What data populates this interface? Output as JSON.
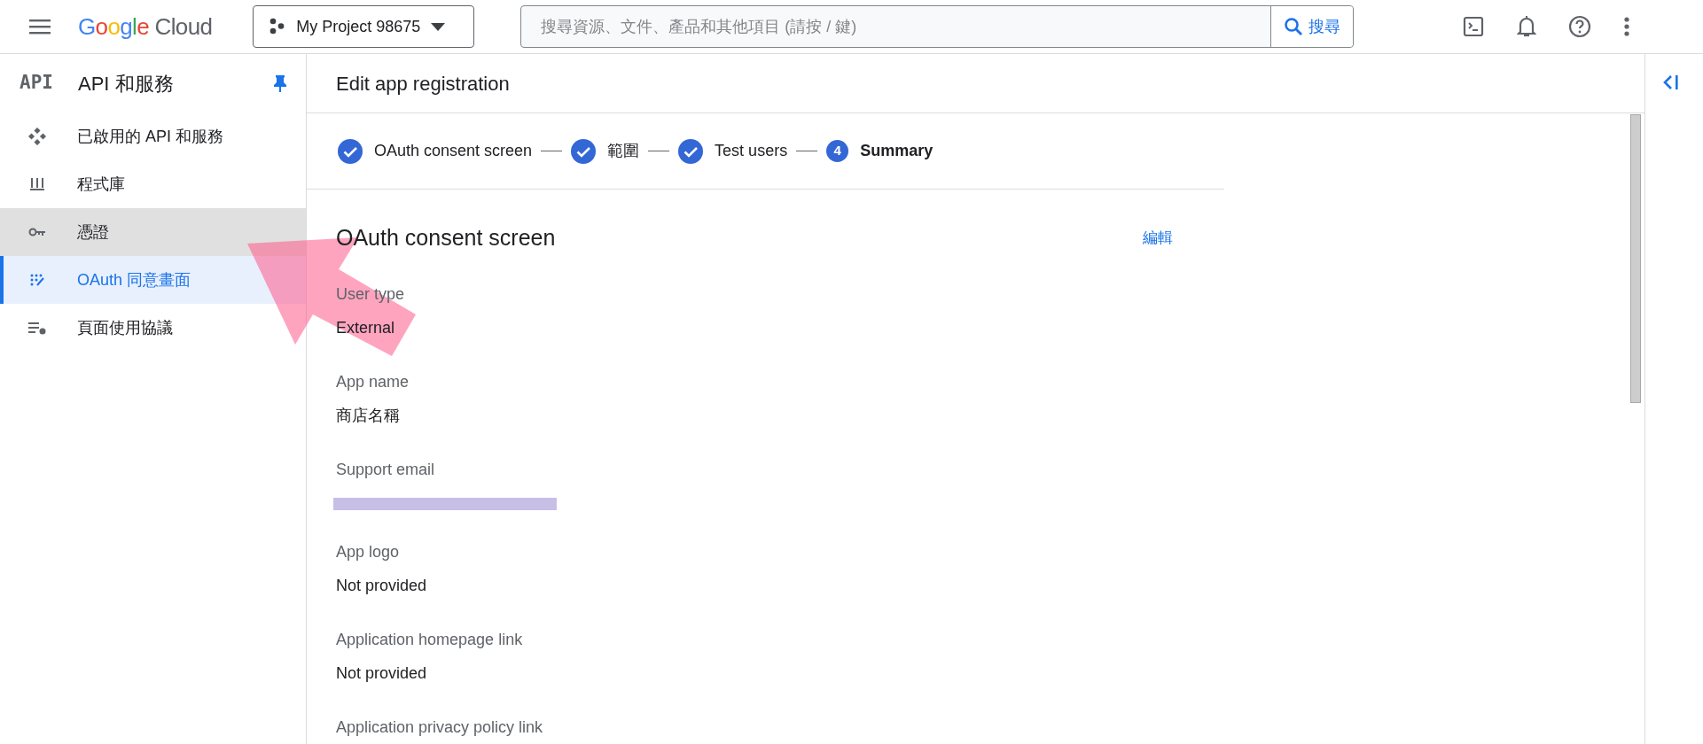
{
  "header": {
    "logo": "Google Cloud",
    "project": "My Project 98675",
    "search": {
      "placeholder": "搜尋資源、文件、產品和其他項目 (請按 / 鍵)",
      "button": "搜尋"
    }
  },
  "sidebar": {
    "badge": "API",
    "title": "API 和服務",
    "pinned": true,
    "items": [
      {
        "label": "已啟用的 API 和服務",
        "selected": false,
        "highlighted": false
      },
      {
        "label": "程式庫",
        "selected": false,
        "highlighted": false
      },
      {
        "label": "憑證",
        "selected": false,
        "highlighted": true
      },
      {
        "label": "OAuth 同意畫面",
        "selected": true,
        "highlighted": false
      },
      {
        "label": "頁面使用協議",
        "selected": false,
        "highlighted": false
      }
    ]
  },
  "page": {
    "title": "Edit app registration",
    "steps": [
      {
        "label": "OAuth consent screen",
        "done": true,
        "selected": false
      },
      {
        "label": "範圍",
        "done": true,
        "selected": false
      },
      {
        "label": "Test users",
        "done": true,
        "selected": false
      },
      {
        "label": "Summary",
        "number": "4",
        "done": false,
        "selected": true
      }
    ],
    "section": {
      "title": "OAuth consent screen",
      "edit": "編輯",
      "fields": [
        {
          "label": "User type",
          "value": "External"
        },
        {
          "label": "App name",
          "value": "商店名稱"
        },
        {
          "label": "Support email",
          "redacted": true
        },
        {
          "label": "App logo",
          "value": "Not provided"
        },
        {
          "label": "Application homepage link",
          "value": "Not provided"
        },
        {
          "label": "Application privacy policy link"
        }
      ]
    }
  }
}
